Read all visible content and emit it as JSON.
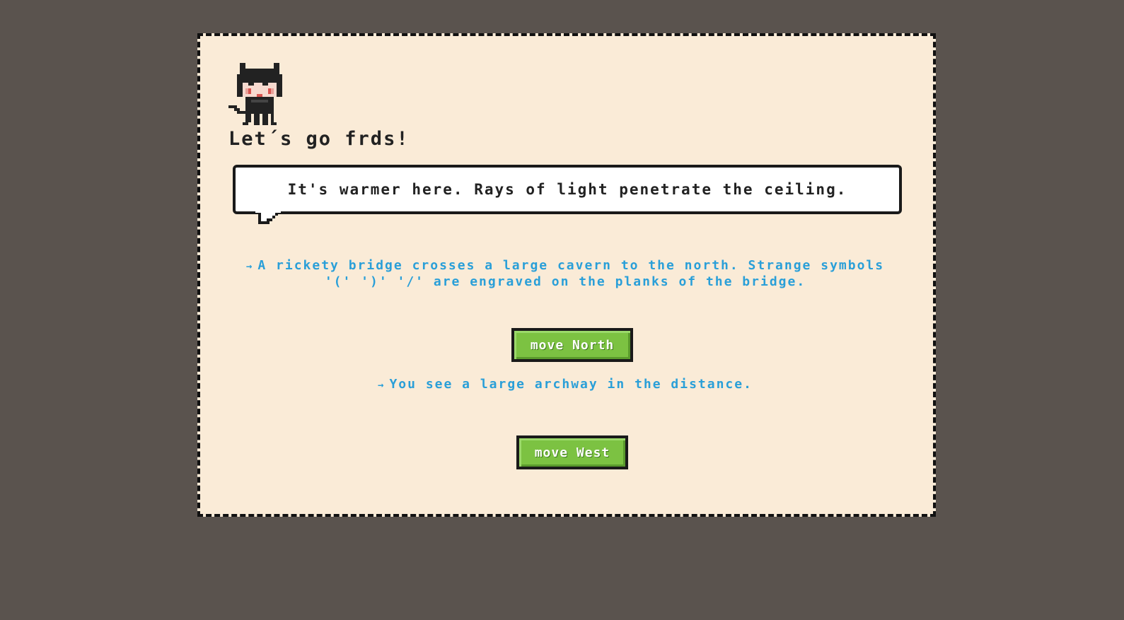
{
  "headline": "Let´s go frds!",
  "speech_bubble": {
    "text": "It's warmer here. Rays of light penetrate the ceiling."
  },
  "choices": [
    {
      "arrow": "→",
      "description": "A rickety bridge crosses a large cavern to the north. Strange symbols '(' ')' '/' are engraved on the planks of the bridge.",
      "button_label": "move North"
    },
    {
      "arrow": "→",
      "description": "You see a large archway in the distance.",
      "button_label": "move West"
    }
  ],
  "colors": {
    "background": "#5a534e",
    "panel": "#faebd7",
    "text_dark": "#222222",
    "description_blue": "#2a9fd8",
    "button_green": "#7cc242"
  },
  "icons": {
    "avatar": "pixel-cat-girl-icon",
    "arrow": "right-arrow-icon"
  }
}
